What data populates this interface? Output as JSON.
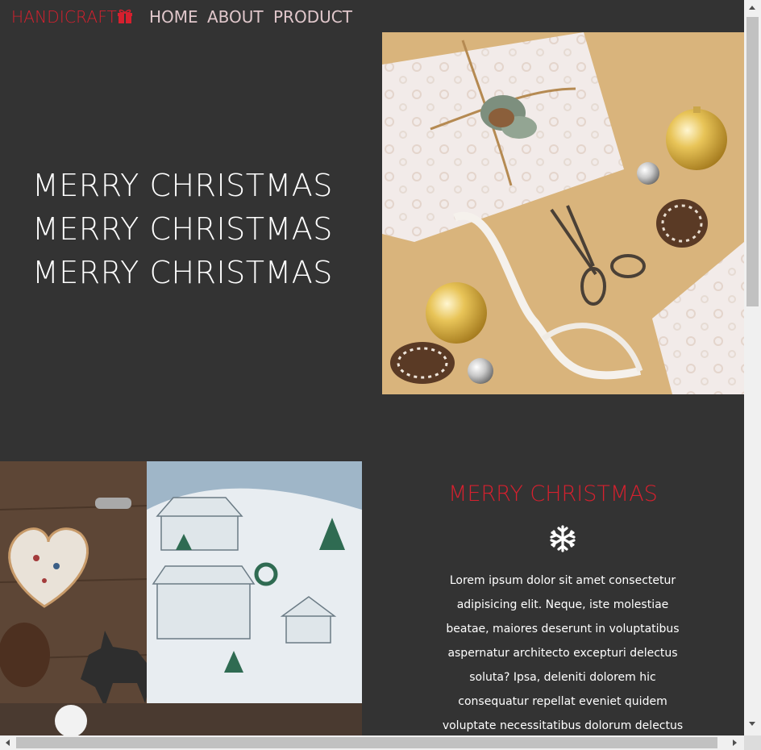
{
  "nav": {
    "brand": "HANDICRAFT",
    "brand_icon": "gift-icon",
    "links": [
      "HOME",
      "ABOUT",
      "PRODUCT"
    ]
  },
  "hero": {
    "lines": [
      "MERRY CHRISTMAS",
      "MERRY CHRISTMAS",
      "MERRY CHRISTMAS"
    ]
  },
  "section": {
    "title": "MERRY CHRISTMAS",
    "icon": "snowflake-icon",
    "body": "Lorem ipsum dolor sit amet consectetur adipisicing elit. Neque, iste molestiae beatae, maiores deserunt in voluptatibus aspernatur architecto excepturi delectus soluta? Ipsa, deleniti dolorem hic consequatur repellat eveniet quidem voluptate necessitatibus dolorum delectus minus vitae, ut, veritatis"
  },
  "colors": {
    "background": "#333333",
    "accent": "#d6202e",
    "nav_link": "#e0c7cb",
    "text": "#ffffff"
  }
}
